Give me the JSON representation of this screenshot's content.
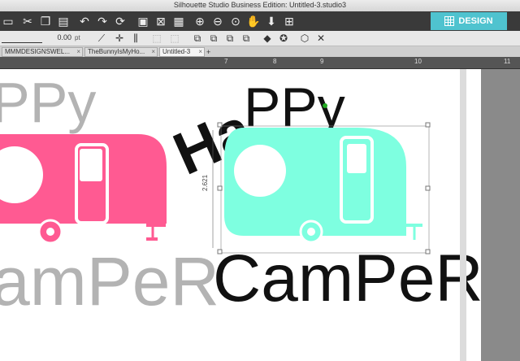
{
  "app": {
    "window_title": "Silhouette Studio Business Edition: Untitled-3.studio3",
    "design_tab_label": "DESIGN"
  },
  "line_options": {
    "thickness_value": "0.00",
    "unit": "pt"
  },
  "tabs": [
    {
      "label": "MMMDESIGNSWEL..."
    },
    {
      "label": "TheBunnyIsMyHo..."
    },
    {
      "label": "Untitled-3"
    }
  ],
  "add_tab_label": "+",
  "ruler": {
    "labels": [
      "7",
      "8",
      "9",
      "10",
      "11"
    ]
  },
  "canvas": {
    "dimension_label": "2.621",
    "left_design": {
      "word_top": "HaPPy",
      "word_bottom": "Camper",
      "color_trailer": "#ff5a92",
      "color_text": "#b3b3b3"
    },
    "right_design": {
      "word_top": "HaPPy",
      "word_bottom": "Camper",
      "color_trailer": "#7effe0",
      "color_text": "#111111"
    }
  },
  "colors": {
    "toolbar_dark": "#3a3a3a",
    "design_accent": "#4fc3cf",
    "selection_handle": "#22aa22"
  },
  "icons": [
    "cut-icon",
    "copy-icon",
    "paste-icon",
    "undo-icon",
    "redo-icon",
    "refresh-icon",
    "group-icon",
    "ungroup-icon",
    "zoom-in-icon",
    "zoom-out-icon",
    "zoom-select-icon",
    "pan-icon",
    "fit-icon",
    "line-icon",
    "move-icon",
    "align-icon",
    "combine-icon",
    "weld-icon",
    "offset-icon",
    "star-icon",
    "3d-icon",
    "close-icon"
  ]
}
